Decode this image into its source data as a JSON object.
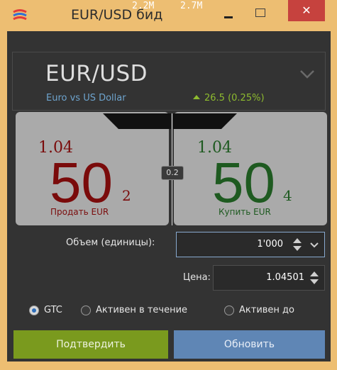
{
  "window": {
    "title": "EUR/USD бид",
    "close_glyph": "✕"
  },
  "instrument": {
    "symbol": "EUR/USD",
    "description": "Euro vs US Dollar",
    "change": "26.5 (0.25%)",
    "change_color": "#8ebb2f"
  },
  "sell": {
    "big_figure": "1.04",
    "pips": "50",
    "pipette": "2",
    "label": "Продать EUR",
    "volume": "2.2M",
    "color": "#7a0b0b"
  },
  "buy": {
    "big_figure": "1.04",
    "pips": "50",
    "pipette": "4",
    "label": "Купить EUR",
    "volume": "2.7M",
    "color": "#1e5a20"
  },
  "spread": "0.2",
  "order": {
    "volume_label": "Объем (единицы):",
    "volume_value": "1'000",
    "price_label": "Цена:",
    "price_value": "1.04501"
  },
  "tif": {
    "options": [
      "GTC",
      "Активен в течение",
      "Активен до"
    ],
    "selected": "GTC"
  },
  "buttons": {
    "confirm": "Подтвердить",
    "update": "Обновить"
  },
  "colors": {
    "frame": "#edbe72",
    "panel": "#333333",
    "tile": "#aaaaaa",
    "confirm": "#7a9a1e",
    "update": "#5f86b5",
    "close": "#c6423e"
  },
  "icons": [
    "app-logo-icon",
    "minimize-icon",
    "maximize-icon",
    "close-icon",
    "chevron-down-icon",
    "arrow-up-icon",
    "spin-up-icon",
    "spin-down-icon"
  ]
}
